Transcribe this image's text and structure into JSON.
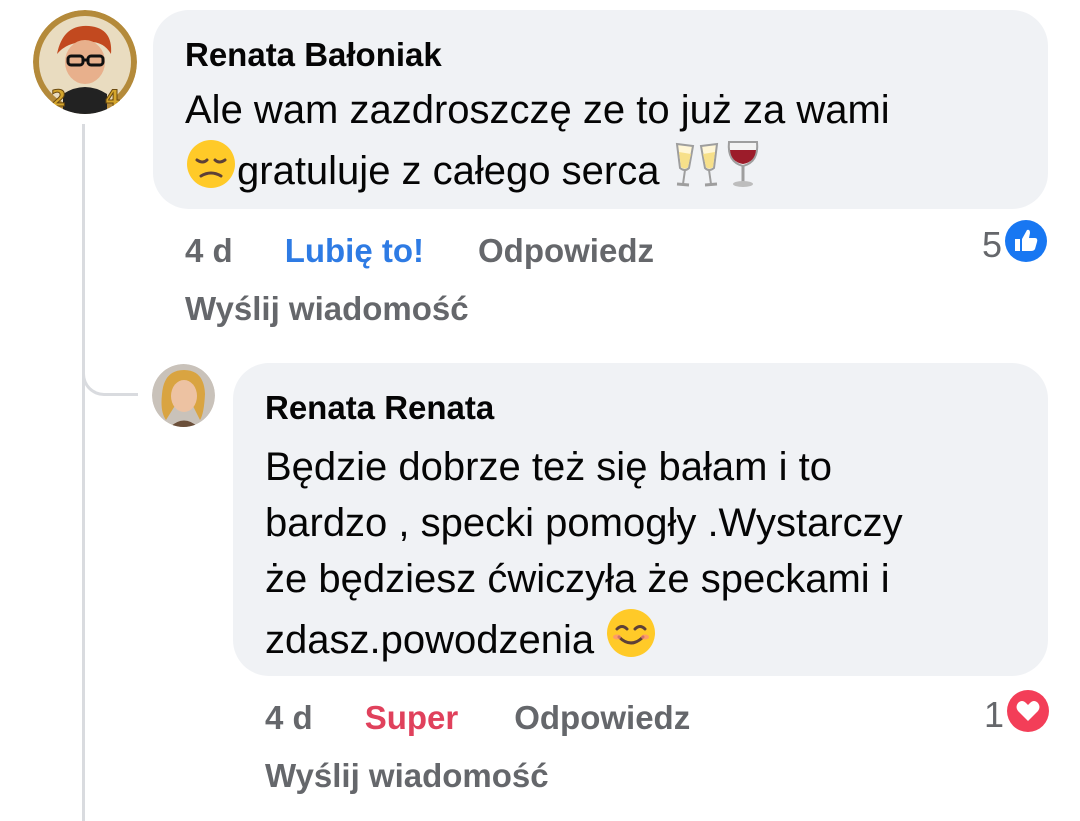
{
  "comments": [
    {
      "author": "Renata Bałoniak",
      "text_lines": [
        "Ale wam zazdroszczę ze to już za wami",
        "gratuluje z całego serca"
      ],
      "emojis": [
        "pensive-face",
        "clinking-glasses",
        "wine-glass"
      ],
      "time": "4 d",
      "reaction_label": "Lubię to!",
      "reply_label": "Odpowiedz",
      "message_label": "Wyślij wiadomość",
      "reaction_count": "5",
      "reaction_icon": "thumbs-up-icon",
      "reaction_color": "#1877f2"
    },
    {
      "author": "Renata Renata",
      "text_lines": [
        "Będzie dobrze też się bałam i to",
        "bardzo , specki pomogły .Wystarczy",
        "że będziesz ćwiczyła że speckami i",
        "zdasz.powodzenia"
      ],
      "emojis": [
        "smiling-face"
      ],
      "time": "4 d",
      "reaction_label": "Super",
      "reply_label": "Odpowiedz",
      "message_label": "Wyślij wiadomość",
      "reaction_count": "1",
      "reaction_icon": "heart-icon",
      "reaction_color": "#f33e58"
    }
  ],
  "colors": {
    "bubble": "#f0f2f5",
    "meta_text": "#65676b",
    "like_blue": "#2e7be4",
    "super_red": "#e0415c",
    "thread_line": "#d9dbdf"
  }
}
